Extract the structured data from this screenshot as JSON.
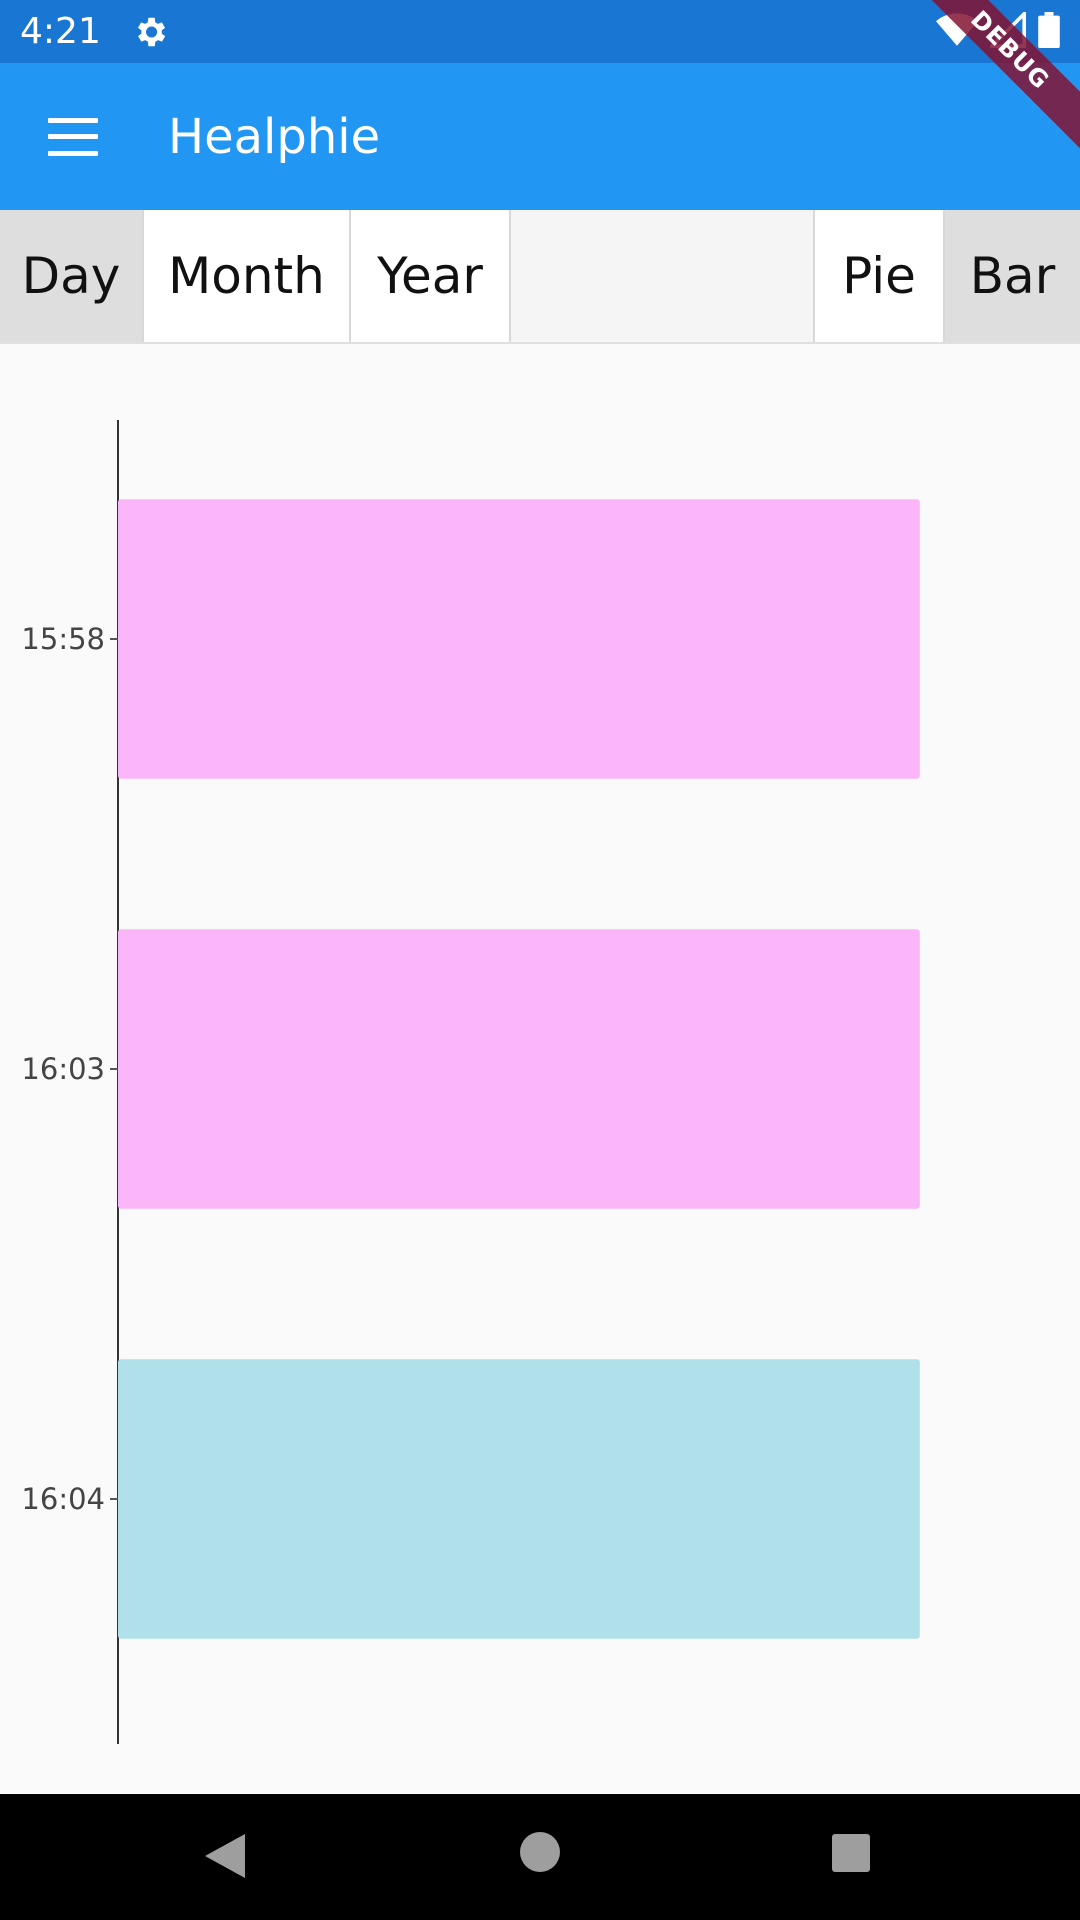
{
  "status_bar": {
    "time": "4:21",
    "icons": [
      "gear-icon",
      "wifi-icon",
      "signal-icon",
      "battery-icon"
    ]
  },
  "debug_banner": "DEBUG",
  "app_bar": {
    "title": "Healphie",
    "menu_icon": "menu-icon"
  },
  "period_tabs": [
    {
      "label": "Day",
      "selected": true
    },
    {
      "label": "Month",
      "selected": false
    },
    {
      "label": "Year",
      "selected": false
    }
  ],
  "chart_tabs": [
    {
      "label": "Pie",
      "selected": false
    },
    {
      "label": "Bar",
      "selected": true
    }
  ],
  "colors": {
    "status_bar": "#1976d2",
    "app_bar": "#2196f3",
    "bar_pink": "#fbb6f9",
    "bar_blue": "#b0e0ea"
  },
  "chart_data": {
    "type": "bar",
    "orientation": "horizontal",
    "categories": [
      "15:58",
      "16:03",
      "16:04"
    ],
    "values": [
      1,
      1,
      1
    ],
    "bar_colors": [
      "#fbb6f9",
      "#fbb6f9",
      "#b0e0ea"
    ],
    "xlim": [
      0,
      1.1
    ]
  }
}
